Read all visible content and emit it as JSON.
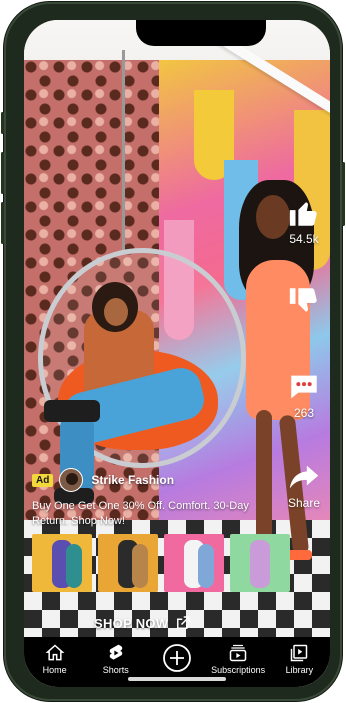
{
  "rail": {
    "like_count": "54.5k",
    "comment_count": "263",
    "share_label": "Share"
  },
  "ad": {
    "badge": "Ad",
    "channel_name": "Strike Fashion",
    "description": "Buy One Get One 30% Off. Comfort. 30-Day Return. Shop Now!",
    "cta_label": "SHOP NOW"
  },
  "nav": {
    "items": [
      {
        "label": "Home",
        "icon": "home-icon"
      },
      {
        "label": "Shorts",
        "icon": "shorts-icon"
      },
      {
        "label": "",
        "icon": "create-icon"
      },
      {
        "label": "Subscriptions",
        "icon": "subscriptions-icon"
      },
      {
        "label": "Library",
        "icon": "library-icon"
      }
    ]
  },
  "colors": {
    "ad_badge": "#f2d83a",
    "nav_bg": "#000000",
    "phone_frame": "#1f2a1e"
  }
}
